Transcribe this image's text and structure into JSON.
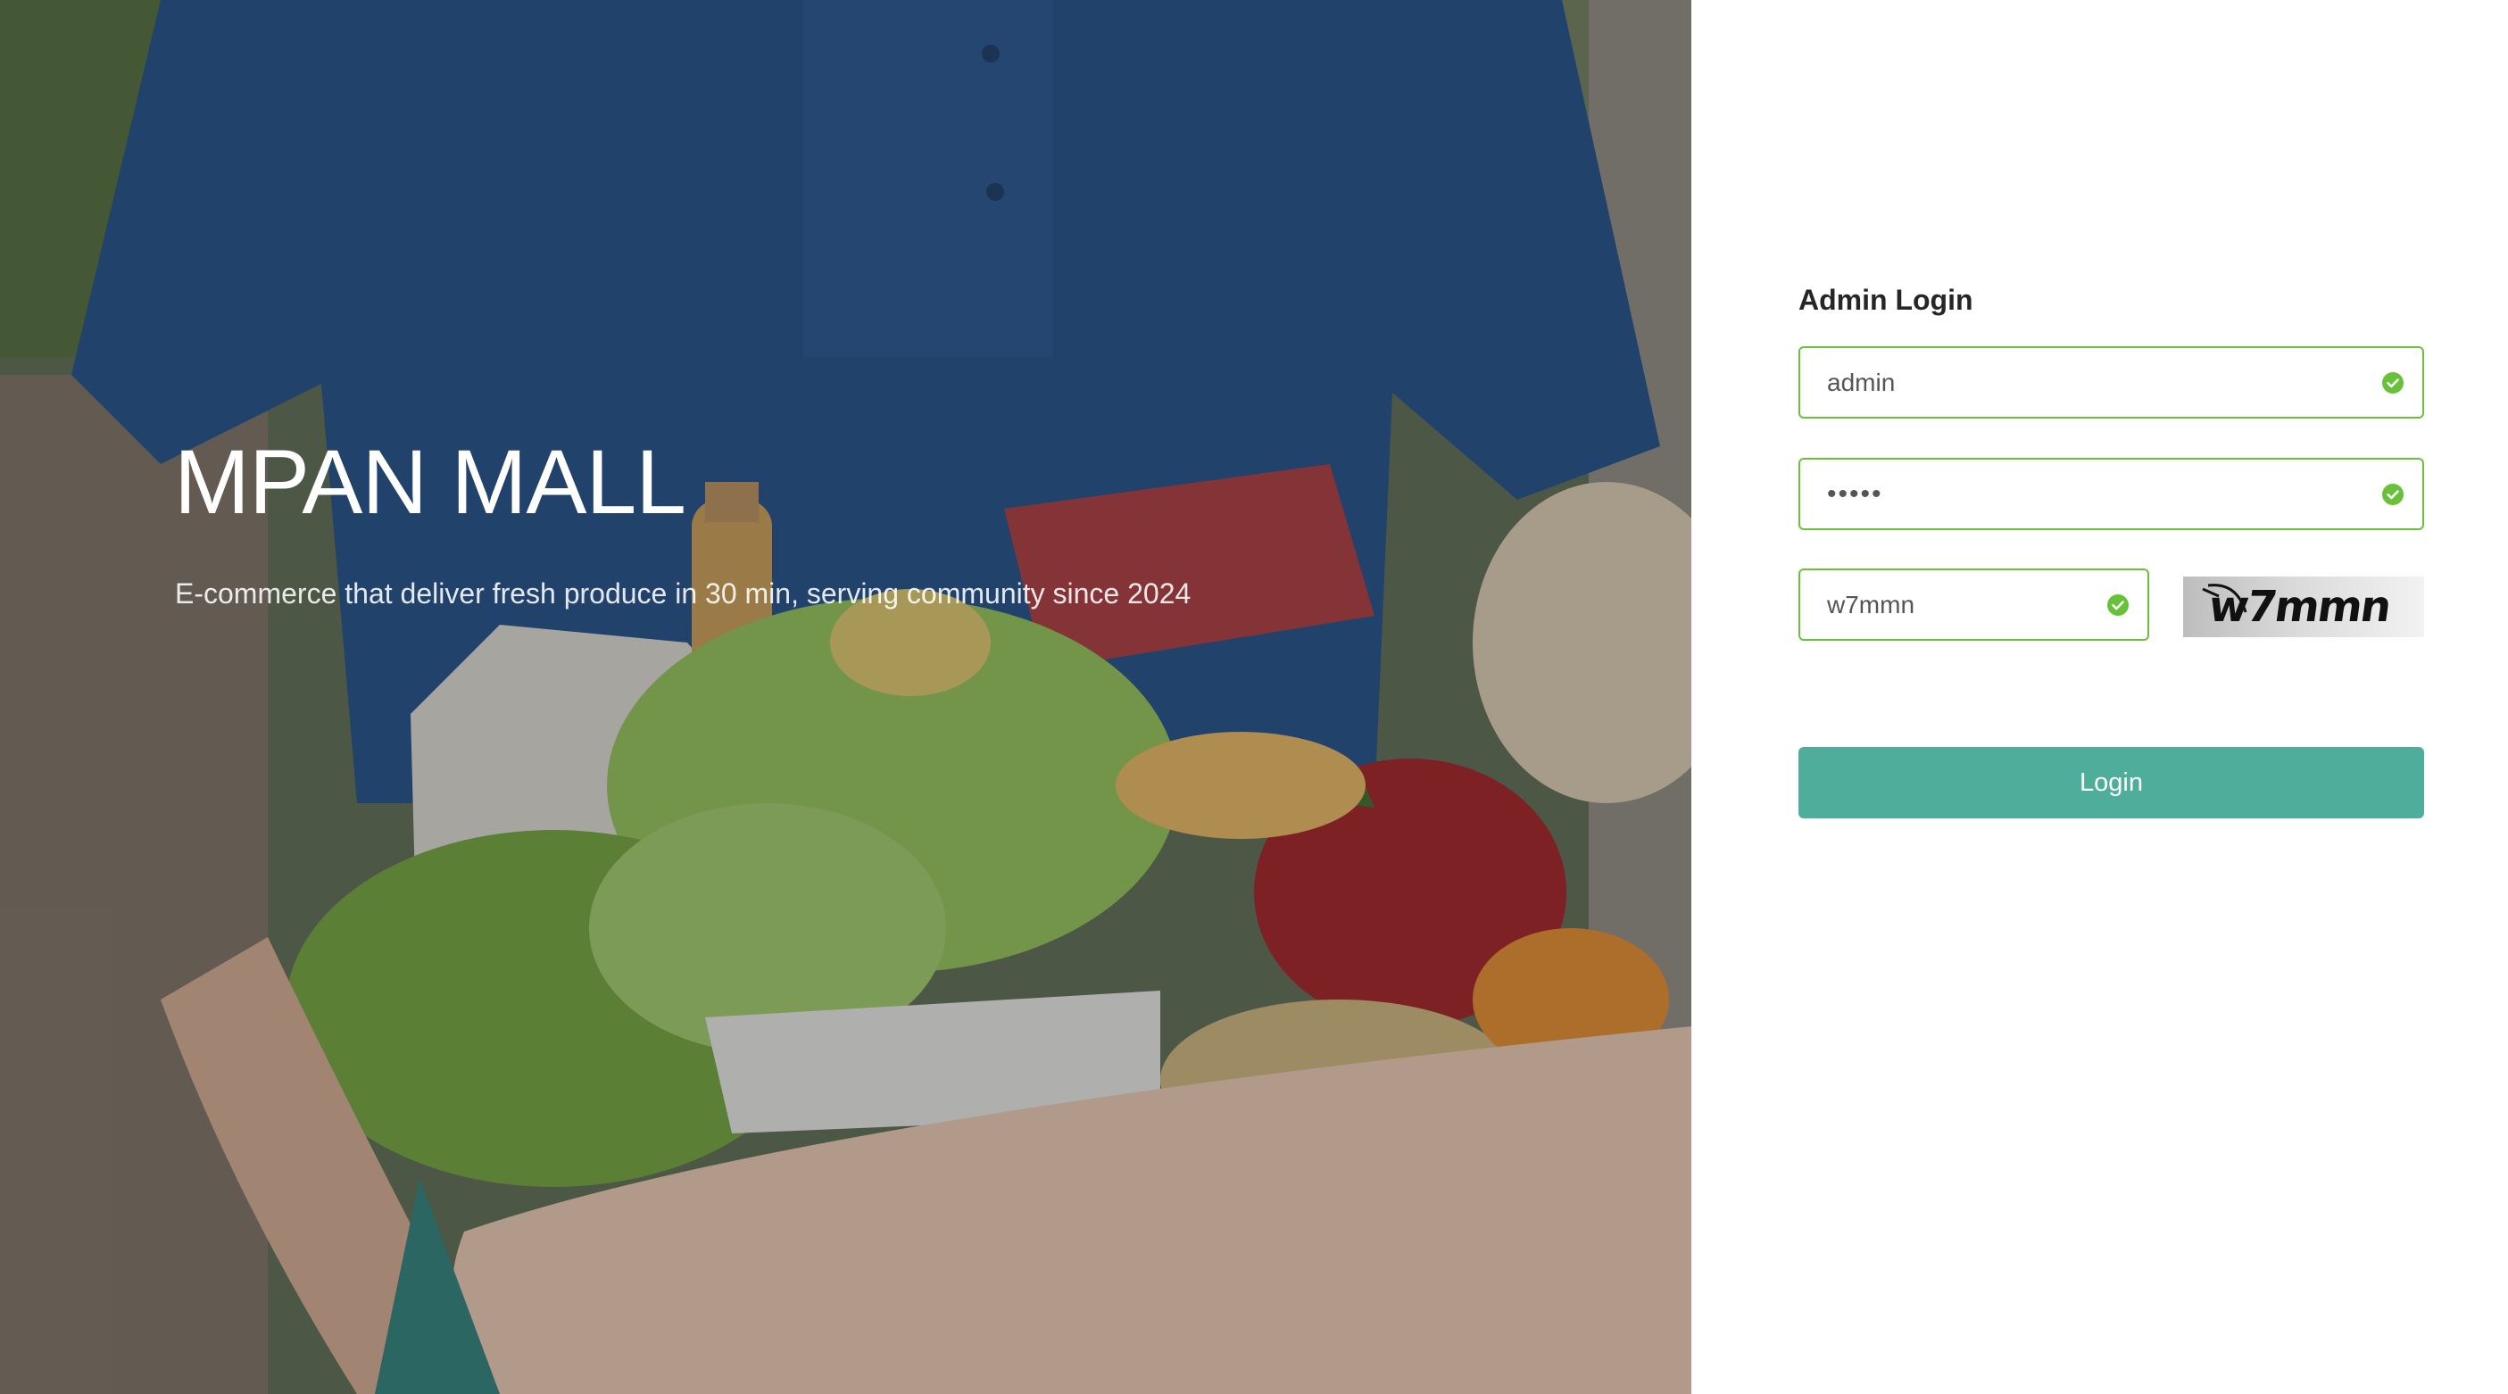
{
  "hero": {
    "title": "MPAN MALL",
    "tagline": "E-commerce that deliver fresh produce in 30 min, serving community since 2024"
  },
  "login": {
    "heading": "Admin Login",
    "username_value": "admin",
    "password_value": "•••••",
    "captcha_input_value": "w7mmn",
    "captcha_image_text": "w7mmn",
    "button_label": "Login"
  },
  "colors": {
    "valid_border": "#67c23a",
    "button_bg": "#4fae9b",
    "heading_text": "#262626"
  },
  "icons": {
    "field_status": "check-circle-icon"
  }
}
